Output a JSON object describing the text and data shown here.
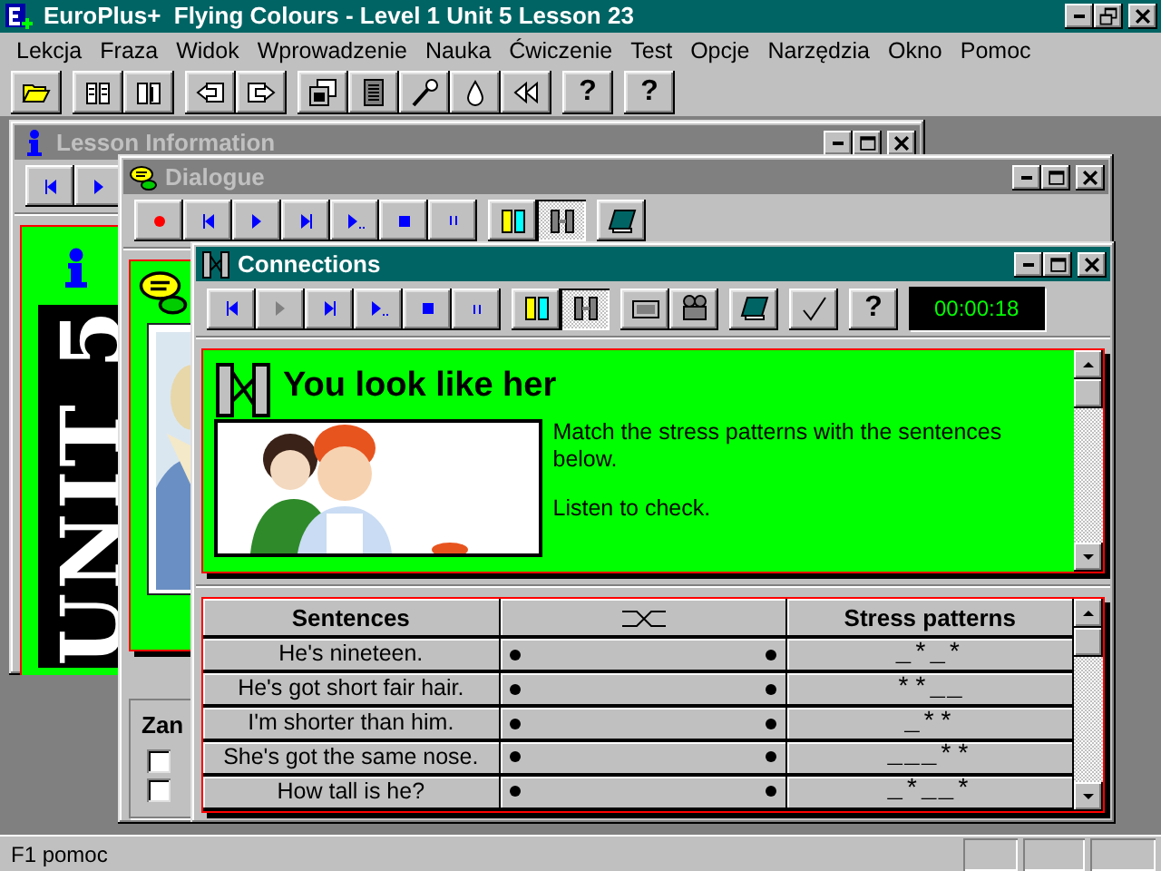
{
  "app": {
    "title": "EuroPlus+  Flying Colours - Level 1 Unit 5 Lesson 23"
  },
  "menu": [
    {
      "label": "Lekcja"
    },
    {
      "label": "Fraza"
    },
    {
      "label": "Widok"
    },
    {
      "label": "Wprowadzenie"
    },
    {
      "label": "Nauka"
    },
    {
      "label": "Ćwiczenie"
    },
    {
      "label": "Test"
    },
    {
      "label": "Opcje"
    },
    {
      "label": "Narzędzia"
    },
    {
      "label": "Okno"
    },
    {
      "label": "Pomoc"
    }
  ],
  "toolbar": {
    "help_buttons": [
      "?",
      "?"
    ]
  },
  "windows": [
    {
      "kind": "lesson_info",
      "title": "Lesson Information",
      "active": false,
      "unit_label": "UNIT 5"
    },
    {
      "kind": "dialogue",
      "title": "Dialogue",
      "active": false,
      "options_group": {
        "label": "Zan",
        "checkboxes": [
          {
            "checked": false
          },
          {
            "checked": false
          }
        ]
      }
    },
    {
      "kind": "connections",
      "title": "Connections",
      "active": true,
      "help_button": "?",
      "timer": "00:00:18",
      "heading": "You look like her",
      "instructions": [
        "Match the stress patterns with the sentences below.",
        "Listen to check."
      ],
      "table": {
        "column_1": "Sentences",
        "column_3": "Stress patterns",
        "rows": [
          {
            "sentence": "He's nineteen.",
            "stress_pattern": "_*_*"
          },
          {
            "sentence": "He's got short fair hair.",
            "stress_pattern": "**__"
          },
          {
            "sentence": "I'm shorter than him.",
            "stress_pattern": "_**"
          },
          {
            "sentence": "She's got the same nose.",
            "stress_pattern": "___**"
          },
          {
            "sentence": "How tall is he?",
            "stress_pattern": "_*__*"
          }
        ]
      }
    }
  ],
  "status_bar": {
    "text": "F1 pomoc"
  }
}
